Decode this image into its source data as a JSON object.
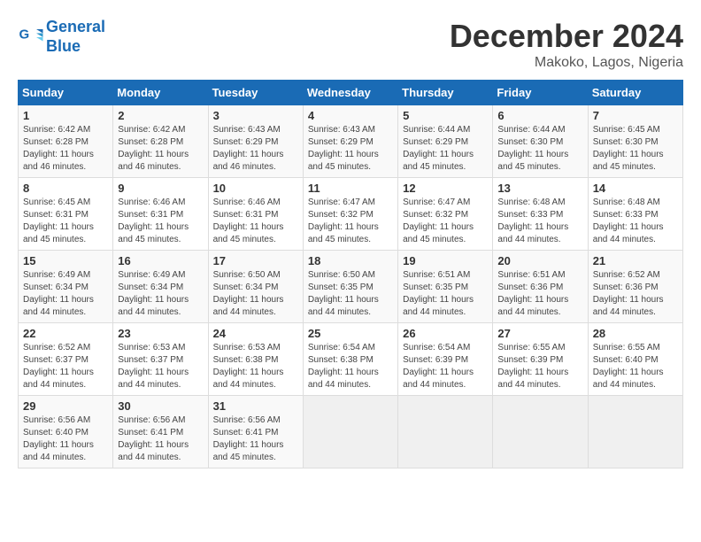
{
  "logo": {
    "line1": "General",
    "line2": "Blue"
  },
  "title": "December 2024",
  "subtitle": "Makoko, Lagos, Nigeria",
  "days_of_week": [
    "Sunday",
    "Monday",
    "Tuesday",
    "Wednesday",
    "Thursday",
    "Friday",
    "Saturday"
  ],
  "weeks": [
    [
      {
        "day": 1,
        "sunrise": "6:42 AM",
        "sunset": "6:28 PM",
        "daylight": "11 hours and 46 minutes."
      },
      {
        "day": 2,
        "sunrise": "6:42 AM",
        "sunset": "6:28 PM",
        "daylight": "11 hours and 46 minutes."
      },
      {
        "day": 3,
        "sunrise": "6:43 AM",
        "sunset": "6:29 PM",
        "daylight": "11 hours and 46 minutes."
      },
      {
        "day": 4,
        "sunrise": "6:43 AM",
        "sunset": "6:29 PM",
        "daylight": "11 hours and 45 minutes."
      },
      {
        "day": 5,
        "sunrise": "6:44 AM",
        "sunset": "6:29 PM",
        "daylight": "11 hours and 45 minutes."
      },
      {
        "day": 6,
        "sunrise": "6:44 AM",
        "sunset": "6:30 PM",
        "daylight": "11 hours and 45 minutes."
      },
      {
        "day": 7,
        "sunrise": "6:45 AM",
        "sunset": "6:30 PM",
        "daylight": "11 hours and 45 minutes."
      }
    ],
    [
      {
        "day": 8,
        "sunrise": "6:45 AM",
        "sunset": "6:31 PM",
        "daylight": "11 hours and 45 minutes."
      },
      {
        "day": 9,
        "sunrise": "6:46 AM",
        "sunset": "6:31 PM",
        "daylight": "11 hours and 45 minutes."
      },
      {
        "day": 10,
        "sunrise": "6:46 AM",
        "sunset": "6:31 PM",
        "daylight": "11 hours and 45 minutes."
      },
      {
        "day": 11,
        "sunrise": "6:47 AM",
        "sunset": "6:32 PM",
        "daylight": "11 hours and 45 minutes."
      },
      {
        "day": 12,
        "sunrise": "6:47 AM",
        "sunset": "6:32 PM",
        "daylight": "11 hours and 45 minutes."
      },
      {
        "day": 13,
        "sunrise": "6:48 AM",
        "sunset": "6:33 PM",
        "daylight": "11 hours and 44 minutes."
      },
      {
        "day": 14,
        "sunrise": "6:48 AM",
        "sunset": "6:33 PM",
        "daylight": "11 hours and 44 minutes."
      }
    ],
    [
      {
        "day": 15,
        "sunrise": "6:49 AM",
        "sunset": "6:34 PM",
        "daylight": "11 hours and 44 minutes."
      },
      {
        "day": 16,
        "sunrise": "6:49 AM",
        "sunset": "6:34 PM",
        "daylight": "11 hours and 44 minutes."
      },
      {
        "day": 17,
        "sunrise": "6:50 AM",
        "sunset": "6:34 PM",
        "daylight": "11 hours and 44 minutes."
      },
      {
        "day": 18,
        "sunrise": "6:50 AM",
        "sunset": "6:35 PM",
        "daylight": "11 hours and 44 minutes."
      },
      {
        "day": 19,
        "sunrise": "6:51 AM",
        "sunset": "6:35 PM",
        "daylight": "11 hours and 44 minutes."
      },
      {
        "day": 20,
        "sunrise": "6:51 AM",
        "sunset": "6:36 PM",
        "daylight": "11 hours and 44 minutes."
      },
      {
        "day": 21,
        "sunrise": "6:52 AM",
        "sunset": "6:36 PM",
        "daylight": "11 hours and 44 minutes."
      }
    ],
    [
      {
        "day": 22,
        "sunrise": "6:52 AM",
        "sunset": "6:37 PM",
        "daylight": "11 hours and 44 minutes."
      },
      {
        "day": 23,
        "sunrise": "6:53 AM",
        "sunset": "6:37 PM",
        "daylight": "11 hours and 44 minutes."
      },
      {
        "day": 24,
        "sunrise": "6:53 AM",
        "sunset": "6:38 PM",
        "daylight": "11 hours and 44 minutes."
      },
      {
        "day": 25,
        "sunrise": "6:54 AM",
        "sunset": "6:38 PM",
        "daylight": "11 hours and 44 minutes."
      },
      {
        "day": 26,
        "sunrise": "6:54 AM",
        "sunset": "6:39 PM",
        "daylight": "11 hours and 44 minutes."
      },
      {
        "day": 27,
        "sunrise": "6:55 AM",
        "sunset": "6:39 PM",
        "daylight": "11 hours and 44 minutes."
      },
      {
        "day": 28,
        "sunrise": "6:55 AM",
        "sunset": "6:40 PM",
        "daylight": "11 hours and 44 minutes."
      }
    ],
    [
      {
        "day": 29,
        "sunrise": "6:56 AM",
        "sunset": "6:40 PM",
        "daylight": "11 hours and 44 minutes."
      },
      {
        "day": 30,
        "sunrise": "6:56 AM",
        "sunset": "6:41 PM",
        "daylight": "11 hours and 44 minutes."
      },
      {
        "day": 31,
        "sunrise": "6:56 AM",
        "sunset": "6:41 PM",
        "daylight": "11 hours and 45 minutes."
      },
      null,
      null,
      null,
      null
    ]
  ]
}
